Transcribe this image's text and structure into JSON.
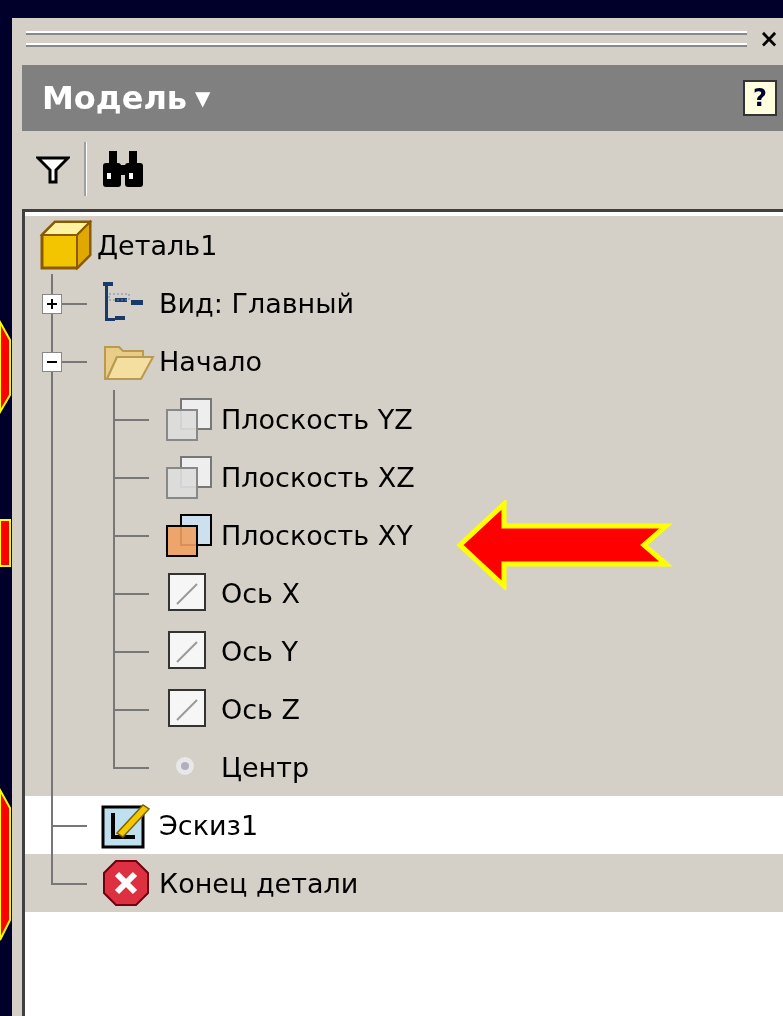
{
  "panel": {
    "close": "×",
    "title": "Модель",
    "title_caret": "▼",
    "help": "?"
  },
  "tree": [
    {
      "label": "Деталь1",
      "kind": "part",
      "shaded": true,
      "children": [
        {
          "label": "Вид: Главный",
          "kind": "view",
          "expanded": false,
          "shaded": true
        },
        {
          "label": "Начало",
          "kind": "folder",
          "expanded": true,
          "shaded": true,
          "children": [
            {
              "label": "Плоскость YZ",
              "kind": "plane",
              "shaded": true
            },
            {
              "label": "Плоскость XZ",
              "kind": "plane",
              "shaded": true
            },
            {
              "label": "Плоскость XY",
              "kind": "plane_active",
              "shaded": true
            },
            {
              "label": "Ось X",
              "kind": "axis",
              "shaded": true
            },
            {
              "label": "Ось Y",
              "kind": "axis",
              "shaded": true
            },
            {
              "label": "Ось Z",
              "kind": "axis",
              "shaded": true
            },
            {
              "label": "Центр",
              "kind": "point",
              "shaded": true
            }
          ]
        },
        {
          "label": "Эскиз1",
          "kind": "sketch",
          "shaded": false
        },
        {
          "label": "Конец детали",
          "kind": "end",
          "shaded": true
        }
      ]
    }
  ]
}
